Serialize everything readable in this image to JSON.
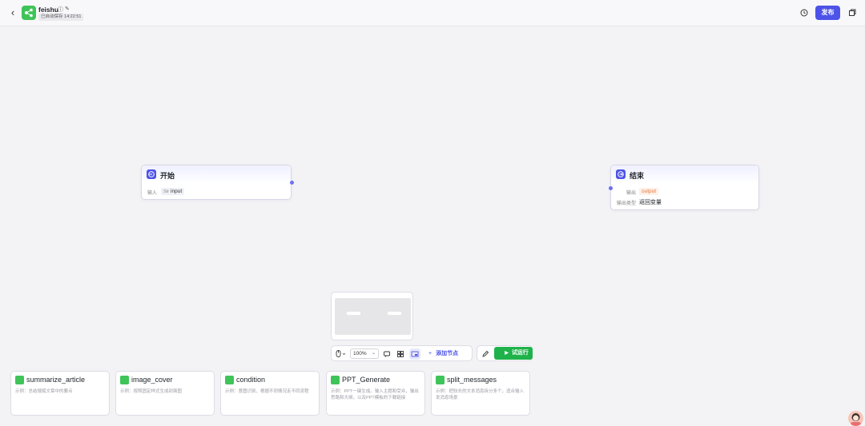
{
  "header": {
    "title": "feishu",
    "autosave": "已自动保存 14:22:51",
    "publish_label": "发布"
  },
  "nodes": {
    "start": {
      "title": "开始",
      "input_label": "输入",
      "input_type": "Str",
      "input_name": "input"
    },
    "end": {
      "title": "结束",
      "output_label": "输出",
      "output_name": "output",
      "output_type_label": "输出类型",
      "output_type_value": "返回变量"
    }
  },
  "toolbar": {
    "zoom": "100%",
    "add_node_label": "添加节点",
    "run_label": "试运行"
  },
  "templates": [
    {
      "title": "summarize_article",
      "desc": "示例：总结搜狐文章中的要点"
    },
    {
      "title": "image_cover",
      "desc": "示例：按照固定样式生成封面图"
    },
    {
      "title": "condition",
      "desc": "示例：意图识别，根据不同情况走不同流程"
    },
    {
      "title": "PPT_Generate",
      "desc": "示例：PPT一键生成。输入主题和受众，输出思路和大纲，以及PPT模板的下载链接"
    },
    {
      "title": "split_messages",
      "desc": "示例：把较长的文本消息拆分多个，适合输入发消息场景"
    }
  ],
  "colors": {
    "accent": "#4d53e8",
    "run": "#1fb24a",
    "app_icon": "#3fc45a"
  }
}
